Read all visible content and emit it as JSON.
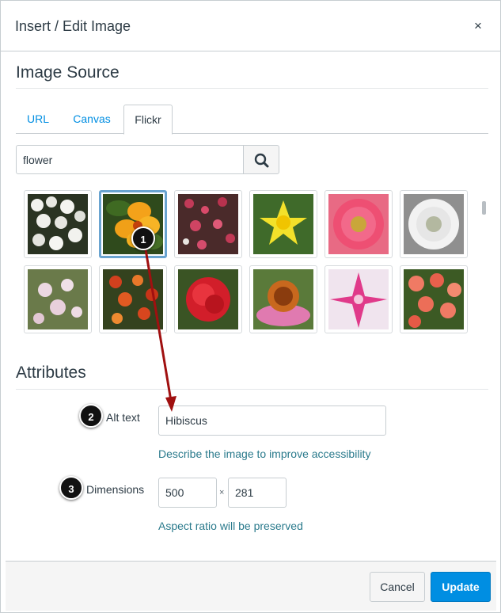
{
  "dialog": {
    "title": "Insert / Edit Image",
    "close_glyph": "×"
  },
  "image_source": {
    "heading": "Image Source",
    "tabs": [
      {
        "label": "URL",
        "active": false
      },
      {
        "label": "Canvas",
        "active": false
      },
      {
        "label": "Flickr",
        "active": true
      }
    ],
    "search": {
      "value": "flower",
      "button_icon": "search-icon"
    }
  },
  "thumbnails": [
    {
      "subject": "white flower cluster",
      "selected": false
    },
    {
      "subject": "yellow hibiscus",
      "selected": true
    },
    {
      "subject": "pink red blossoms",
      "selected": false
    },
    {
      "subject": "yellow daffodil",
      "selected": false
    },
    {
      "subject": "pink gerbera",
      "selected": false
    },
    {
      "subject": "white daisy",
      "selected": false
    },
    {
      "subject": "pale pink flowers",
      "selected": false
    },
    {
      "subject": "red orange flowers",
      "selected": false
    },
    {
      "subject": "red carnation",
      "selected": false
    },
    {
      "subject": "coneflower",
      "selected": false
    },
    {
      "subject": "pink lily",
      "selected": false
    },
    {
      "subject": "coral begonias",
      "selected": false
    }
  ],
  "attributes": {
    "heading": "Attributes",
    "alt_text": {
      "label": "Alt text",
      "value": "Hibiscus",
      "help": "Describe the image to improve accessibility"
    },
    "dimensions": {
      "label": "Dimensions",
      "width": "500",
      "height": "281",
      "separator": "×",
      "help": "Aspect ratio will be preserved"
    }
  },
  "callouts": [
    "1",
    "2",
    "3"
  ],
  "footer": {
    "cancel_label": "Cancel",
    "update_label": "Update"
  },
  "colors": {
    "accent": "#008ee2",
    "selection_border": "#6aa4d0",
    "callout_arrow": "#a01010",
    "help_text": "#2a7a8c"
  }
}
